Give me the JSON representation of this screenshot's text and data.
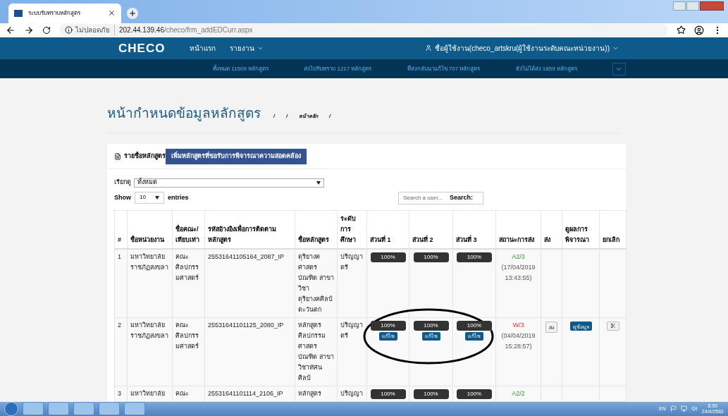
{
  "browser": {
    "tab_title": "ระบบรับทราบหลักสูตร",
    "security": "ไม่ปลอดภัย",
    "url_host": "202.44.139.46",
    "url_path": "/checo/frm_addEDCurr.aspx"
  },
  "navbar": {
    "logo": "CHECO",
    "items": [
      {
        "label": "หน้าแรก",
        "dropdown": false
      },
      {
        "label": "รายงาน",
        "dropdown": true
      }
    ],
    "user": "ชื่อผู้ใช้งาน(checo_artskru(ผู้ใช้งานระดับคณะหน่วยงาน))"
  },
  "stats": [
    "ทั้งหมด 11509 หลักสูตร",
    "ส่งไปรับทราบ 1217 หลักสูตร",
    "ที่ส่งกลับมาแก้ไข 707 หลักสูตร",
    "ยังไม่ได้ส่ง 1859 หลักสูตร"
  ],
  "page": {
    "title": "หน้ากำหนดข้อมูลหลักสูตร",
    "breadcrumb": [
      "/",
      "/",
      "หน้าหลัก",
      "/"
    ]
  },
  "card": {
    "heading": "รายชื่อหลักสูตร",
    "add_button": "เพิ่มหลักสูตรที่ขอรับการพิจารณาความสอดคล้อง",
    "filter_label": "เรียกดู",
    "filter_value": "ทั้งหมด",
    "show_label": "Show",
    "show_value": "10",
    "entries_label": "entries",
    "search_label": "Search:",
    "search_placeholder": "Search a user..."
  },
  "table": {
    "columns": [
      "#",
      "ชื่อหน่วยงาน",
      "ชื่อคณะ/เทียบเท่า",
      "รหัสอ้างอิงเพื่อการติดตามหลักสูตร",
      "ชื่อหลักสูตร",
      "ระดับการศึกษา",
      "ส่วนที่ 1",
      "ส่วนที่ 2",
      "ส่วนที่ 3",
      "สถานะการส่ง",
      "ส่ง",
      "ดูผลการพิจารณา",
      "ยกเลิก"
    ],
    "rows": [
      {
        "no": "1",
        "unit": "มหาวิทยาลัยราชภัฏสงขลา",
        "faculty": "คณะศิลปกรรมศาสตร์",
        "code": "25531641105164_2087_IP",
        "name": "ดุริยางคศาสตรบัณฑิต สาขาวิชาดุริยางคศิลป์ตะวันตก",
        "level": "ปริญญาตรี",
        "parts": [
          {
            "label": "100%",
            "level": 1
          },
          {
            "label": "100%",
            "level": 1
          },
          {
            "label": "100%",
            "level": 1
          }
        ],
        "status": {
          "text": "A2/3",
          "kind": "approved",
          "time": "(17/04/2019 13:43:55)"
        }
      },
      {
        "no": "2",
        "unit": "มหาวิทยาลัยราชภัฏสงขลา",
        "faculty": "คณะศิลปกรรมศาสตร์",
        "code": "25531641101125_2080_IP",
        "name": "หลักสูตรศิลปกรรมศาสตรบัณฑิต สาขาวิชาทัศนศิลป์",
        "level": "ปริญญาตรี",
        "parts": [
          {
            "label": "100%",
            "level": 1,
            "edit": "แก้ไข"
          },
          {
            "label": "100%",
            "level": 1,
            "edit": "แก้ไข"
          },
          {
            "label": "100%",
            "level": 1,
            "edit": "แก้ไข"
          }
        ],
        "status": {
          "text": "W/3",
          "kind": "returned",
          "time": "(04/04/2019 15:28:57)"
        },
        "send": "ส่ง",
        "view": "ดูข้อมูล",
        "cancel": true
      },
      {
        "no": "3",
        "unit": "มหาวิทยาลัย",
        "faculty": "คณะ",
        "code": "25531641101114_2106_IP",
        "name": "หลักสูตร",
        "level": "ปริญญา",
        "parts": [
          {
            "label": "100%",
            "level": 1
          },
          {
            "label": "100%",
            "level": 1
          },
          {
            "label": "100%",
            "level": 1
          }
        ],
        "status": {
          "text": "A2/2",
          "kind": "approved"
        }
      }
    ]
  },
  "taskbar": {
    "language": "EN",
    "time": "8:50",
    "date": "24/4/2562"
  }
}
